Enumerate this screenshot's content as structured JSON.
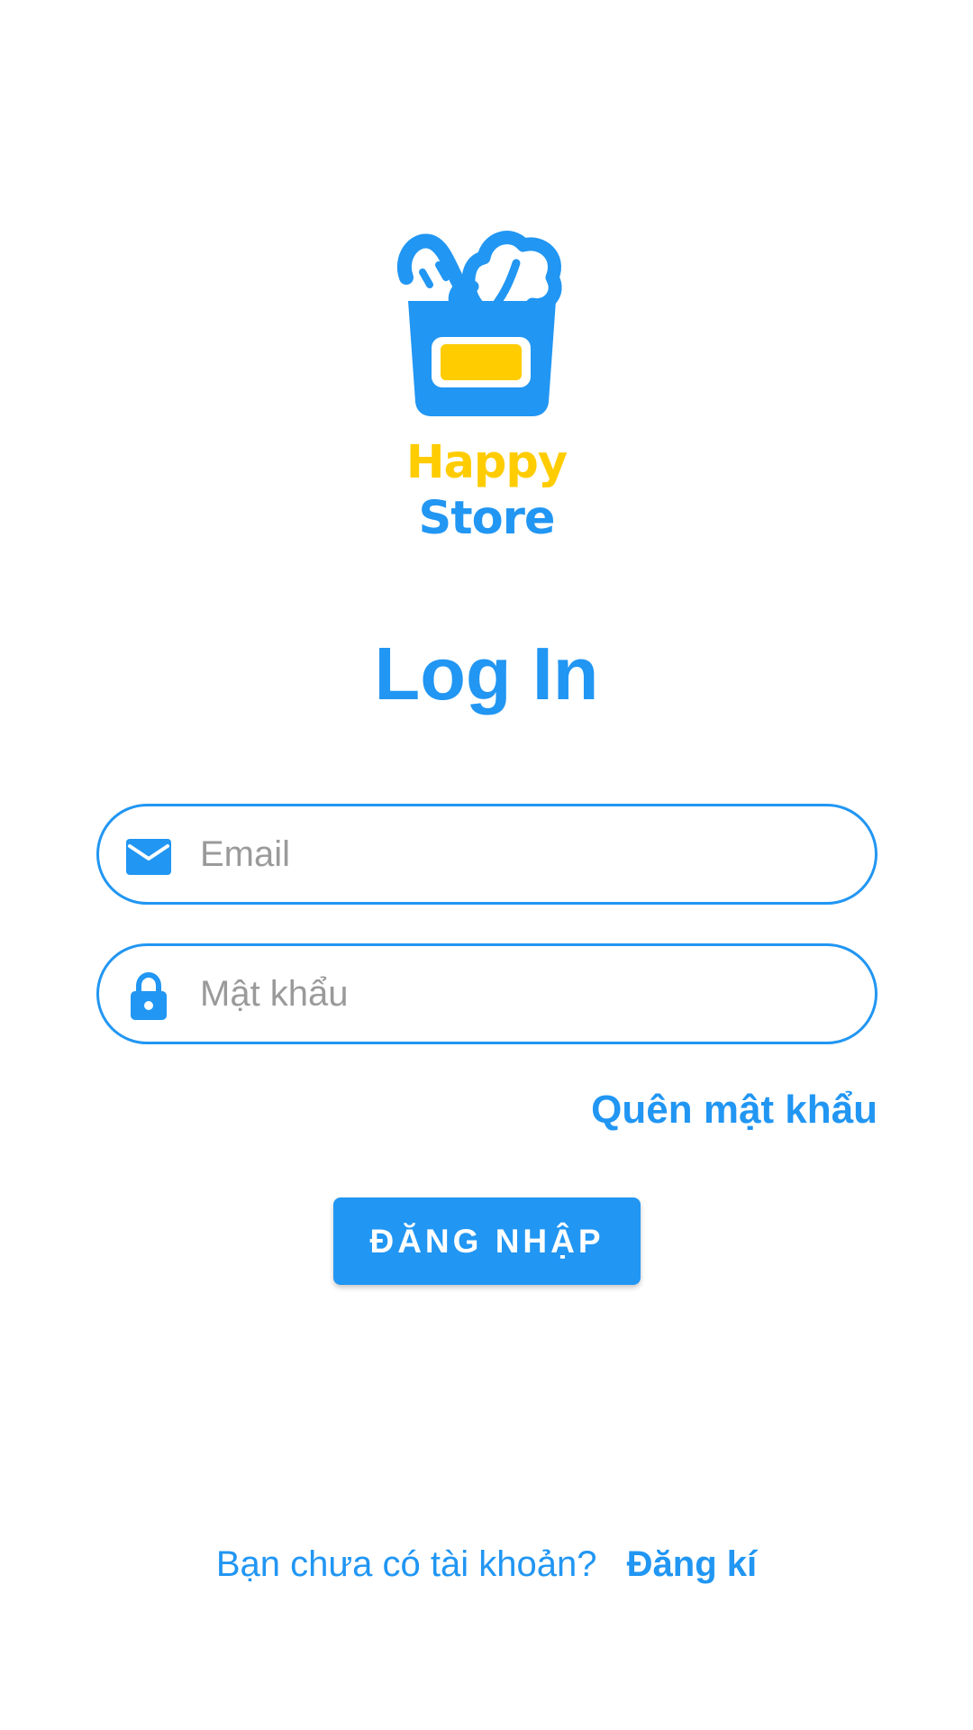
{
  "colors": {
    "primary": "#2196F3",
    "accent": "#FFCC00",
    "border": "#2196F3",
    "placeholder": "#9a9a9a",
    "background": "#ffffff"
  },
  "logo": {
    "icon": "shopping-basket-icon",
    "line1": "Happy",
    "line2": "Store"
  },
  "title": "Log In",
  "email_field": {
    "icon": "mail-icon",
    "value": "",
    "placeholder": "Email"
  },
  "password_field": {
    "icon": "lock-icon",
    "value": "",
    "placeholder": "Mật khẩu"
  },
  "forgot_password": "Quên mật khẩu",
  "login_button": "ĐĂNG NHẬP",
  "signup": {
    "prompt": "Bạn chưa có tài khoản?",
    "link": "Đăng kí"
  }
}
